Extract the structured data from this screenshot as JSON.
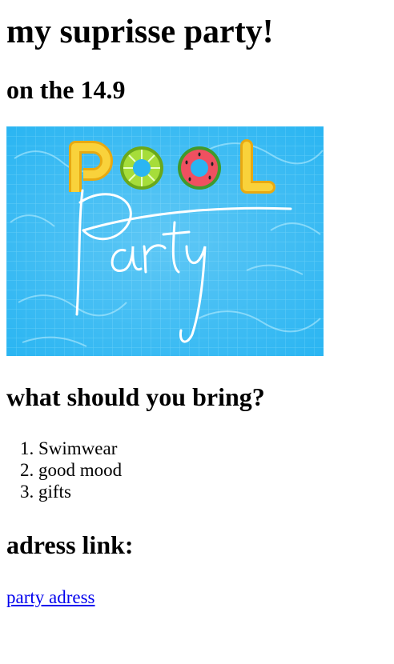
{
  "page": {
    "title": "my suprisse party!",
    "date_heading": "on the 14.9",
    "banner": {
      "word1": "POOL",
      "word2": "Party",
      "colors": {
        "water": "#29b6f6",
        "water_light": "#7fdcff",
        "letters": "#f7c520",
        "lime_ring": "#7cc41f",
        "watermelon_ring": "#e8434f",
        "script": "#ffffff"
      }
    },
    "bring_heading": "what should you bring?",
    "bring_items": [
      "Swimwear",
      "good mood",
      "gifts"
    ],
    "address_heading": "adress link:",
    "address_link": "party adress"
  }
}
